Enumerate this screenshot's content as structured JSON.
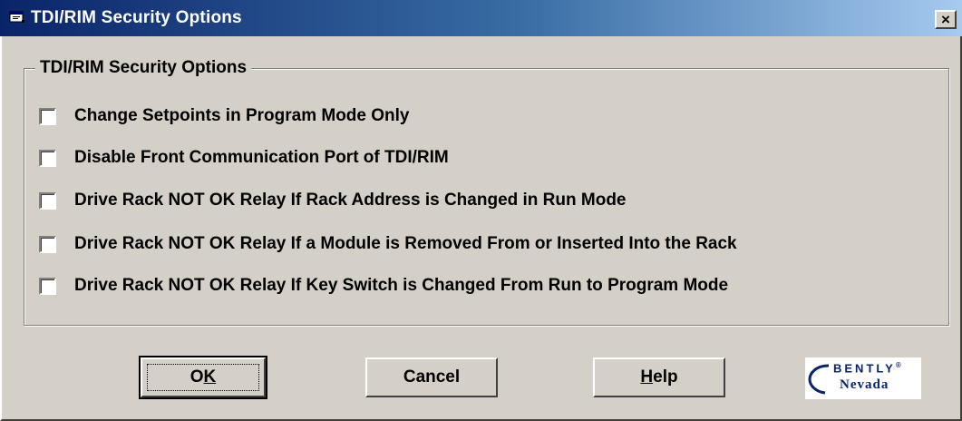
{
  "window": {
    "title": "TDI/RIM Security Options",
    "close_glyph": "×",
    "icon": "app-window-icon"
  },
  "group": {
    "legend": "TDI/RIM Security Options",
    "options": [
      {
        "label": "Change Setpoints in Program Mode Only",
        "checked": false
      },
      {
        "label": "Disable Front Communication Port of TDI/RIM",
        "checked": false
      },
      {
        "label": "Drive Rack NOT OK Relay If Rack Address is Changed in Run Mode",
        "checked": false
      },
      {
        "label": "Drive Rack NOT OK Relay If a Module is Removed From or Inserted Into the Rack",
        "checked": false
      },
      {
        "label": "Drive Rack NOT OK Relay If Key Switch is Changed From Run to Program Mode",
        "checked": false
      }
    ]
  },
  "buttons": {
    "ok": {
      "label_main": "O",
      "label_accel": "K"
    },
    "cancel": {
      "label": "Cancel"
    },
    "help": {
      "label_accel": "H",
      "label_rest": "elp"
    }
  },
  "logo": {
    "top_text": "BENTLY",
    "registered": "®",
    "bottom_text": "Nevada"
  },
  "colors": {
    "title_start": "#0a246a",
    "title_end": "#a6caf0",
    "face": "#d4d0c8",
    "logo_blue": "#0a246a"
  }
}
